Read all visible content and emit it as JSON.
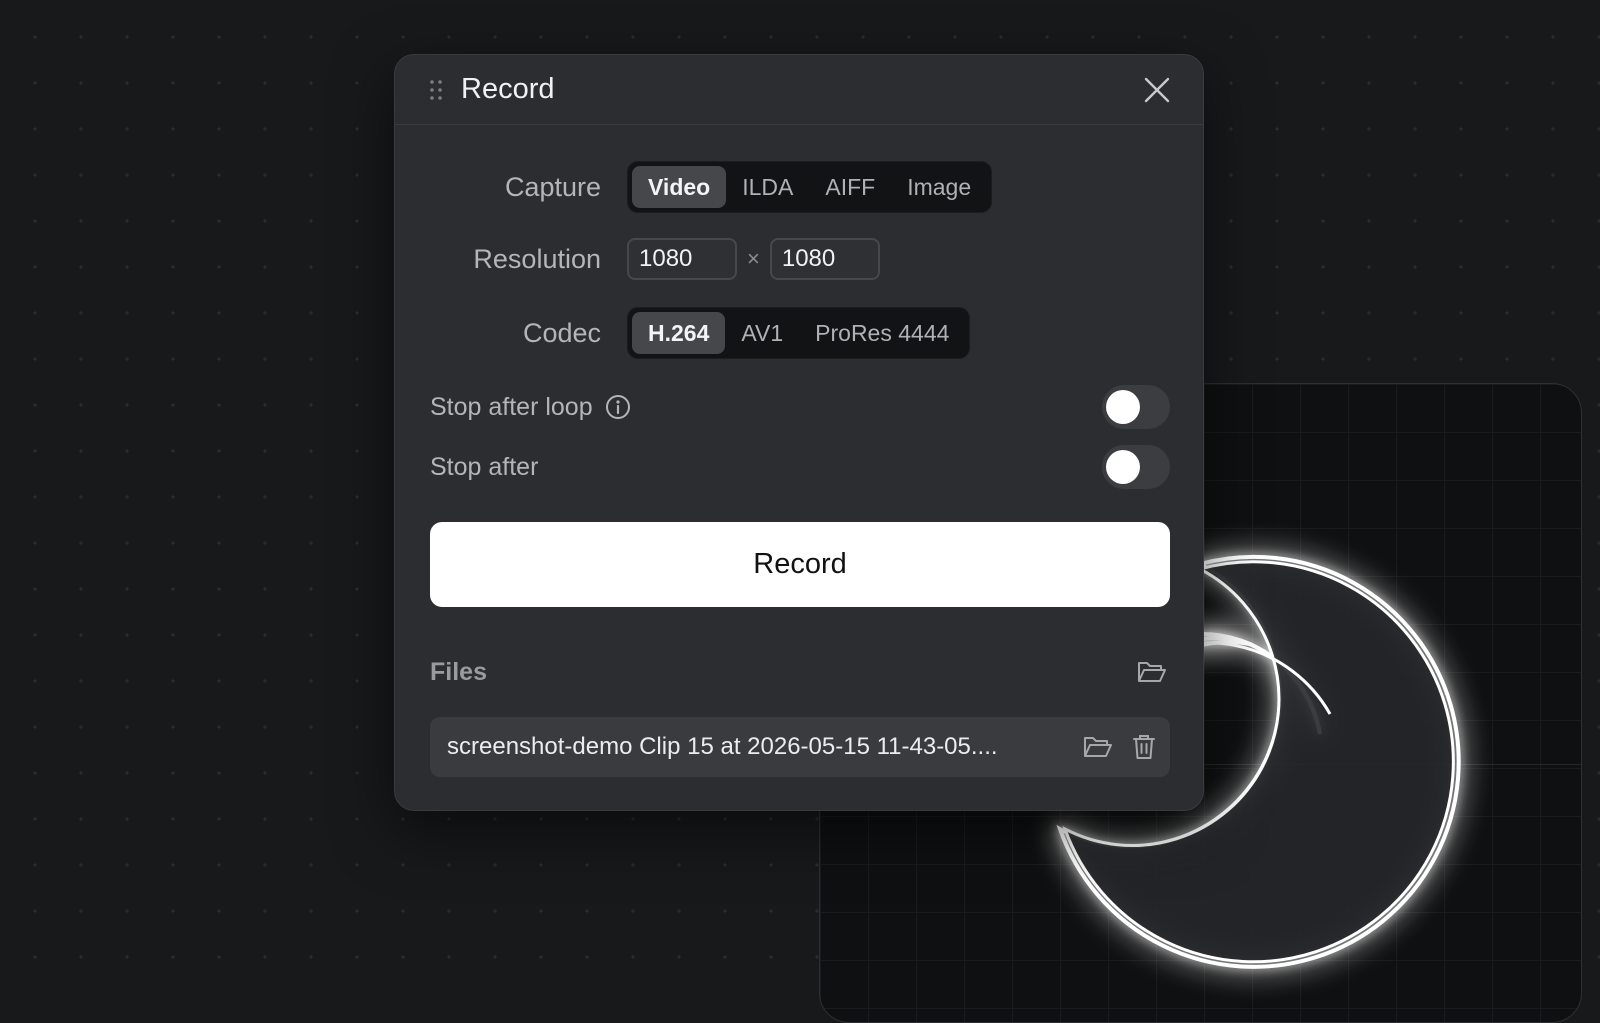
{
  "dialog": {
    "title": "Record",
    "close_icon": "close-icon",
    "drag_icon": "drag-handle-icon"
  },
  "capture": {
    "label": "Capture",
    "options": [
      "Video",
      "ILDA",
      "AIFF",
      "Image"
    ],
    "selected": "Video"
  },
  "resolution": {
    "label": "Resolution",
    "width": "1080",
    "separator": "×",
    "height": "1080"
  },
  "codec": {
    "label": "Codec",
    "options": [
      "H.264",
      "AV1",
      "ProRes 4444"
    ],
    "selected": "H.264"
  },
  "stop_after_loop": {
    "label": "Stop after loop",
    "enabled": false,
    "info_icon": "info-icon"
  },
  "stop_after": {
    "label": "Stop after",
    "enabled": false
  },
  "record_button": {
    "label": "Record"
  },
  "files": {
    "title": "Files",
    "open_folder_icon": "folder-open-icon",
    "items": [
      {
        "name": "screenshot-demo Clip 15 at 2026-05-15 11-43-05....",
        "reveal_icon": "folder-open-icon",
        "delete_icon": "trash-icon"
      }
    ]
  },
  "colors": {
    "background": "#18191b",
    "dialog": "#2c2d30",
    "accent_button": "#ffffff",
    "segment_active": "#46474b"
  }
}
